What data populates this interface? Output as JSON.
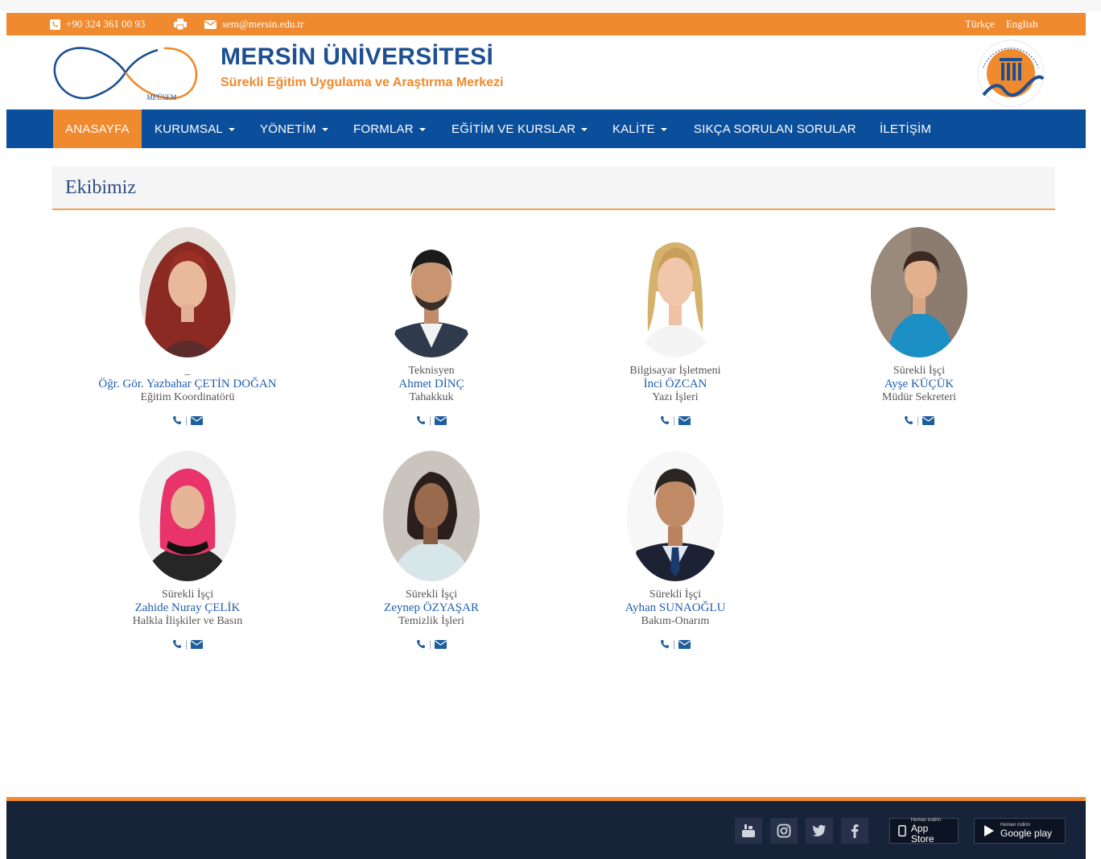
{
  "topbar": {
    "phone": "+90 324 361 00 93",
    "email": "sem@mersin.edu.tr",
    "lang_tr": "Türkçe",
    "lang_en": "English"
  },
  "header": {
    "title": "MERSİN ÜNİVERSİTESİ",
    "subtitle": "Sürekli Eğitim Uygulama ve Araştırma Merkezi",
    "logo_text": "MEÜSEM"
  },
  "nav": {
    "items": [
      {
        "label": "ANASAYFA",
        "active": true
      },
      {
        "label": "KURUMSAL",
        "dropdown": true
      },
      {
        "label": "YÖNETİM",
        "dropdown": true
      },
      {
        "label": "FORMLAR",
        "dropdown": true
      },
      {
        "label": "EĞİTİM VE KURSLAR",
        "dropdown": true
      },
      {
        "label": "KALİTE",
        "dropdown": true
      },
      {
        "label": "SIKÇA SORULAN SORULAR"
      },
      {
        "label": "İLETİŞİM"
      }
    ]
  },
  "section": {
    "title": "Ekibimiz"
  },
  "team": [
    {
      "role": "_",
      "name": "Öğr. Gör. Yazbahar ÇETİN DOĞAN",
      "duty": "Eğitim Koordinatörü"
    },
    {
      "role": "Teknisyen",
      "name": "Ahmet DİNÇ",
      "duty": "Tahakkuk"
    },
    {
      "role": "Bilgisayar İşletmeni",
      "name": "İnci ÖZCAN",
      "duty": "Yazı İşleri"
    },
    {
      "role": "Sürekli İşçi",
      "name": "Ayşe KÜÇÜK",
      "duty": "Müdür Sekreteri"
    },
    {
      "role": "Sürekli İşçi",
      "name": "Zahide Nuray ÇELİK",
      "duty": "Halkla İlişkiler ve Basın"
    },
    {
      "role": "Sürekli İşçi",
      "name": "Zeynep ÖZYAŞAR",
      "duty": "Temizlik İşleri"
    },
    {
      "role": "Sürekli İşçi",
      "name": "Ayhan SUNAOĞLU",
      "duty": "Bakım-Onarım"
    }
  ],
  "footer": {
    "social": [
      "youtube-icon",
      "instagram-icon",
      "twitter-icon",
      "facebook-icon"
    ],
    "appstore_small": "Hemen indirin",
    "appstore_big": "App Store",
    "googleplay_small": "Hemen indirin",
    "googleplay_big": "Google play"
  },
  "colors": {
    "orange": "#f08a2e",
    "navy": "#0b4f9c",
    "footer": "#172339",
    "link_blue": "#1f5eb0"
  }
}
